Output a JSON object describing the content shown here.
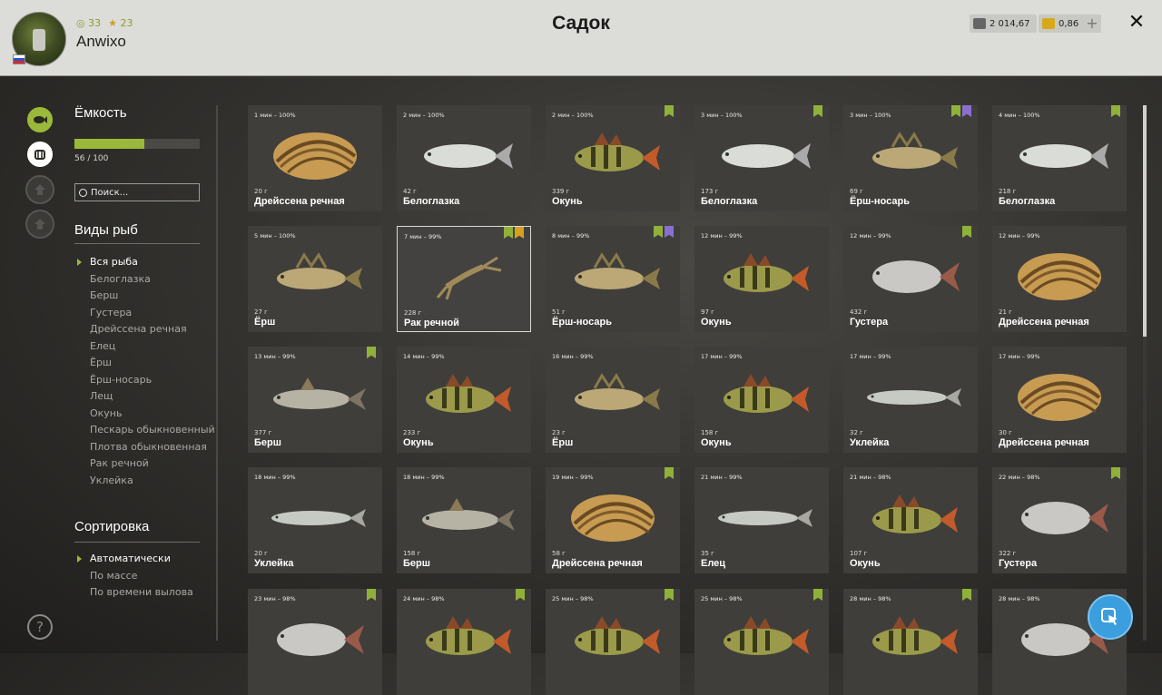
{
  "header": {
    "title": "Садок",
    "user": {
      "name": "Anwixo",
      "level": "33",
      "rating": "23"
    },
    "currency": {
      "silver": "2 014,67",
      "gold": "0,86"
    },
    "plus_label": "+",
    "close_label": "✕"
  },
  "sidebar": {
    "capacity_title": "Ёмкость",
    "capacity_text": "56 / 100",
    "capacity_fraction": 0.56,
    "search_placeholder": "Поиск...",
    "species_title": "Виды рыб",
    "species": [
      "Вся рыба",
      "Белоглазка",
      "Берш",
      "Густера",
      "Дрейссена речная",
      "Елец",
      "Ёрш",
      "Ёрш-носарь",
      "Лещ",
      "Окунь",
      "Пескарь обыкновенный",
      "Плотва обыкновенная",
      "Рак речной",
      "Уклейка"
    ],
    "sort_title": "Сортировка",
    "sort_options": [
      "Автоматически",
      "По массе",
      "По времени вылова"
    ],
    "help_label": "?"
  },
  "grid": [
    {
      "time": "1 мин – 100%",
      "weight": "20 г",
      "name": "Дрейссена речная",
      "kind": "shell",
      "badges": []
    },
    {
      "time": "2 мин – 100%",
      "weight": "42 г",
      "name": "Белоглазка",
      "kind": "silver",
      "badges": []
    },
    {
      "time": "2 мин – 100%",
      "weight": "339 г",
      "name": "Окунь",
      "kind": "perch",
      "badges": [
        "green"
      ]
    },
    {
      "time": "3 мин – 100%",
      "weight": "173 г",
      "name": "Белоглазка",
      "kind": "silver",
      "badges": [
        "green"
      ]
    },
    {
      "time": "3 мин – 100%",
      "weight": "69 г",
      "name": "Ёрш-носарь",
      "kind": "ruffe",
      "badges": [
        "green",
        "purple"
      ]
    },
    {
      "time": "4 мин – 100%",
      "weight": "218 г",
      "name": "Белоглазка",
      "kind": "silver",
      "badges": [
        "green"
      ]
    },
    {
      "time": "5 мин – 100%",
      "weight": "27 г",
      "name": "Ёрш",
      "kind": "ruffe",
      "badges": []
    },
    {
      "time": "7 мин – 99%",
      "weight": "228 г",
      "name": "Рак речной",
      "kind": "crayfish",
      "badges": [
        "green",
        "gold"
      ]
    },
    {
      "time": "8 мин – 99%",
      "weight": "51 г",
      "name": "Ёрш-носарь",
      "kind": "ruffe",
      "badges": [
        "green",
        "purple"
      ]
    },
    {
      "time": "12 мин – 99%",
      "weight": "97 г",
      "name": "Окунь",
      "kind": "perch",
      "badges": []
    },
    {
      "time": "12 мин – 99%",
      "weight": "432 г",
      "name": "Густера",
      "kind": "bream",
      "badges": [
        "green"
      ]
    },
    {
      "time": "12 мин – 99%",
      "weight": "21 г",
      "name": "Дрейссена речная",
      "kind": "shell",
      "badges": []
    },
    {
      "time": "13 мин – 99%",
      "weight": "377 г",
      "name": "Берш",
      "kind": "zander",
      "badges": [
        "green"
      ]
    },
    {
      "time": "14 мин – 99%",
      "weight": "233 г",
      "name": "Окунь",
      "kind": "perch",
      "badges": []
    },
    {
      "time": "16 мин – 99%",
      "weight": "23 г",
      "name": "Ёрш",
      "kind": "ruffe",
      "badges": []
    },
    {
      "time": "17 мин – 99%",
      "weight": "158 г",
      "name": "Окунь",
      "kind": "perch",
      "badges": []
    },
    {
      "time": "17 мин – 99%",
      "weight": "32 г",
      "name": "Уклейка",
      "kind": "slim",
      "badges": []
    },
    {
      "time": "17 мин – 99%",
      "weight": "30 г",
      "name": "Дрейссена речная",
      "kind": "shell",
      "badges": []
    },
    {
      "time": "18 мин – 99%",
      "weight": "20 г",
      "name": "Уклейка",
      "kind": "slim",
      "badges": []
    },
    {
      "time": "18 мин – 99%",
      "weight": "158 г",
      "name": "Берш",
      "kind": "zander",
      "badges": []
    },
    {
      "time": "19 мин – 99%",
      "weight": "58 г",
      "name": "Дрейссена речная",
      "kind": "shell",
      "badges": [
        "green"
      ]
    },
    {
      "time": "21 мин – 99%",
      "weight": "35 г",
      "name": "Елец",
      "kind": "slim",
      "badges": []
    },
    {
      "time": "21 мин – 98%",
      "weight": "107 г",
      "name": "Окунь",
      "kind": "perch",
      "badges": []
    },
    {
      "time": "22 мин – 98%",
      "weight": "322 г",
      "name": "Густера",
      "kind": "bream",
      "badges": [
        "green"
      ]
    },
    {
      "time": "23 мин – 98%",
      "weight": "",
      "name": "",
      "kind": "bream",
      "badges": [
        "green"
      ]
    },
    {
      "time": "24 мин – 98%",
      "weight": "",
      "name": "",
      "kind": "perch",
      "badges": [
        "green"
      ]
    },
    {
      "time": "25 мин – 98%",
      "weight": "",
      "name": "",
      "kind": "perch",
      "badges": [
        "green"
      ]
    },
    {
      "time": "25 мин – 98%",
      "weight": "",
      "name": "",
      "kind": "perch",
      "badges": [
        "green"
      ]
    },
    {
      "time": "28 мин – 98%",
      "weight": "",
      "name": "",
      "kind": "perch",
      "badges": [
        "green"
      ]
    },
    {
      "time": "28 мин – 98%",
      "weight": "",
      "name": "",
      "kind": "bream",
      "badges": []
    }
  ],
  "selected_index": 7,
  "colors": {
    "accent": "#9ab93a",
    "badge_green": "#8fb13a",
    "badge_purple": "#8a6fd0",
    "badge_gold": "#d6a11d",
    "fab": "#3b9ede"
  },
  "icons": {
    "rail": [
      "fish-icon",
      "keepnet-icon",
      "gear-locked-icon",
      "home-locked-icon"
    ],
    "fab": "cursor-icon"
  }
}
